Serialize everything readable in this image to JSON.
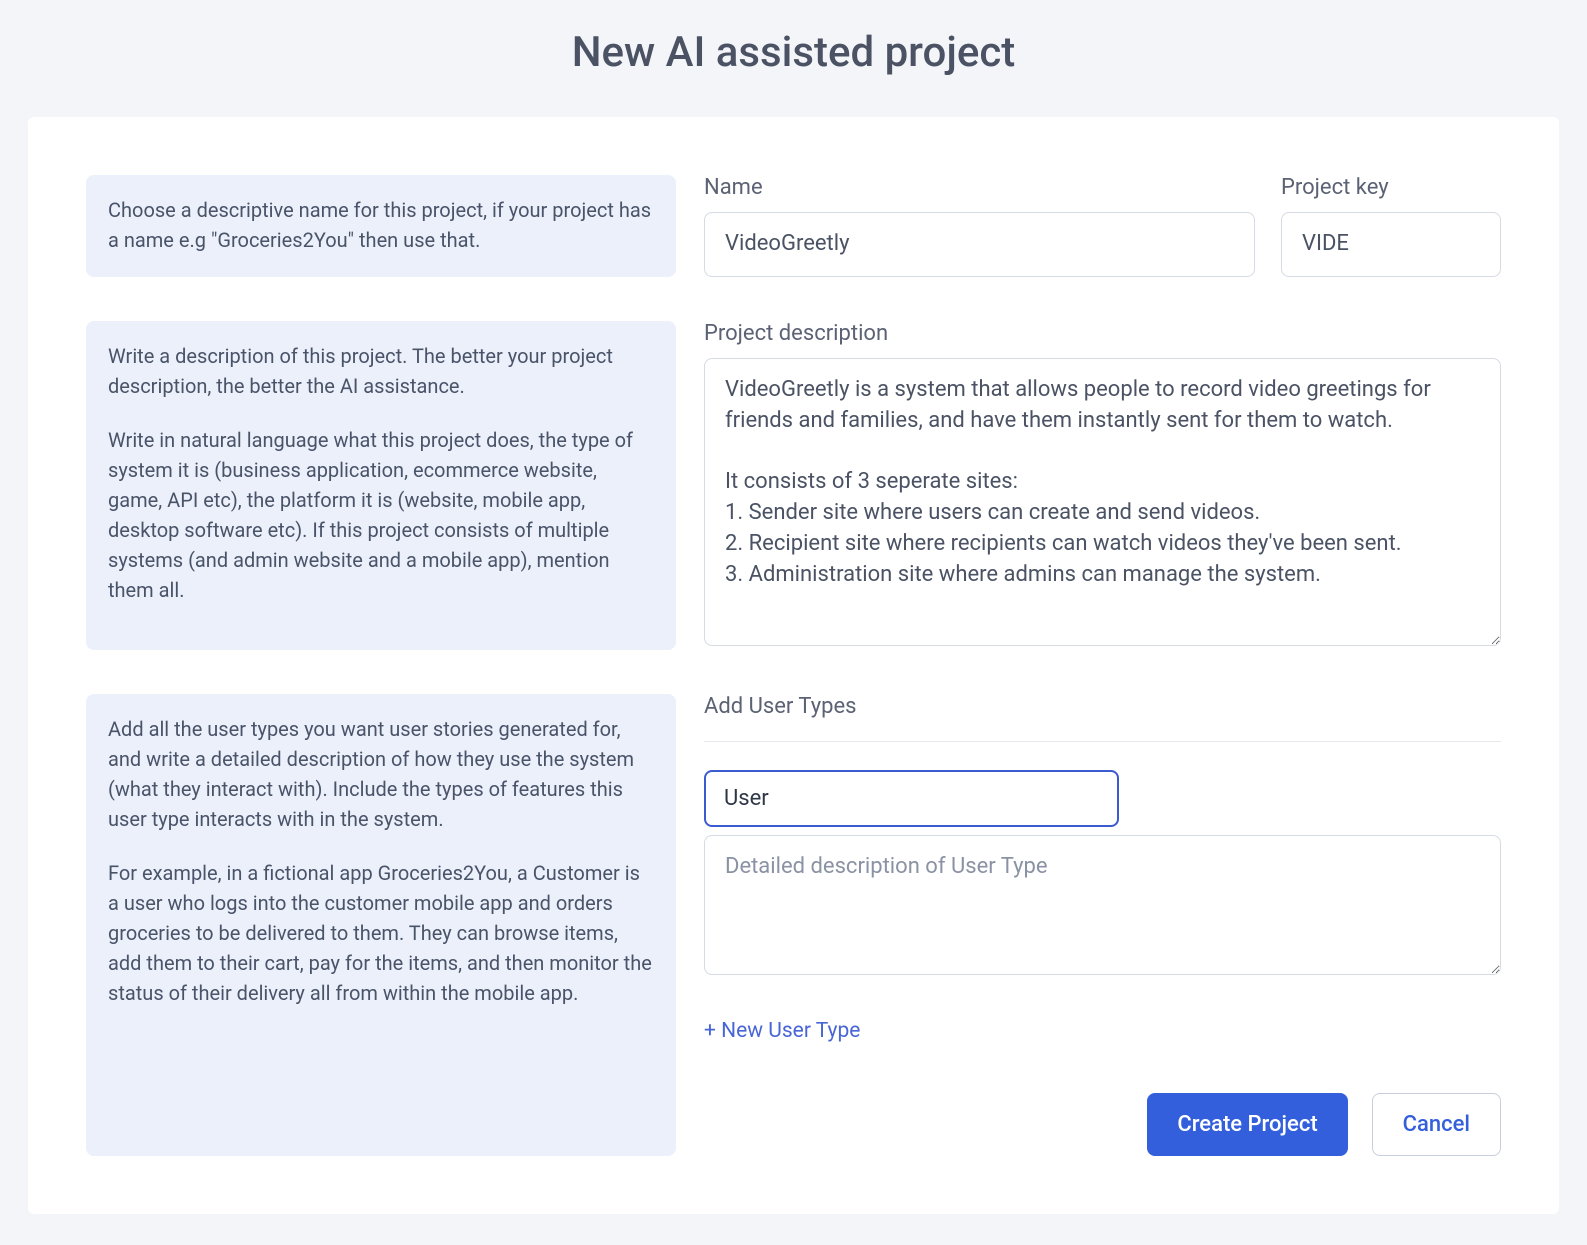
{
  "title": "New AI assisted project",
  "help": {
    "name": "Choose a descriptive name for this project, if your project has a name e.g \"Groceries2You\" then use that.",
    "description_p1": "Write a description of this project. The better your project description, the better the AI assistance.",
    "description_p2": "Write in natural language what this project does, the type of system it is (business application, ecommerce website, game, API etc), the platform it is (website, mobile app, desktop software etc). If this project consists of multiple systems (and admin website and a mobile app), mention them all.",
    "usertypes_p1": "Add all the user types you want user stories generated for, and write a detailed description of how they use the system (what they interact with). Include the types of features this user type interacts with in the system.",
    "usertypes_p2": "For example, in a fictional app Groceries2You, a Customer is a user who logs into the customer mobile app and orders groceries to be delivered to them. They can browse items, add them to their cart, pay for the items, and then monitor the status of their delivery all from within the mobile app."
  },
  "form": {
    "name_label": "Name",
    "name_value": "VideoGreetly",
    "key_label": "Project key",
    "key_value": "VIDE",
    "desc_label": "Project description",
    "desc_value": "VideoGreetly is a system that allows people to record video greetings for friends and families, and have them instantly sent for them to watch.\n\nIt consists of 3 seperate sites:\n1. Sender site where users can create and send videos.\n2. Recipient site where recipients can watch videos they've been sent.\n3. Administration site where admins can manage the system.",
    "usertypes_label": "Add User Types",
    "ut_name_value": "User",
    "ut_desc_placeholder": "Detailed description of User Type",
    "add_user_type": "+ New User Type"
  },
  "actions": {
    "create": "Create Project",
    "cancel": "Cancel"
  }
}
